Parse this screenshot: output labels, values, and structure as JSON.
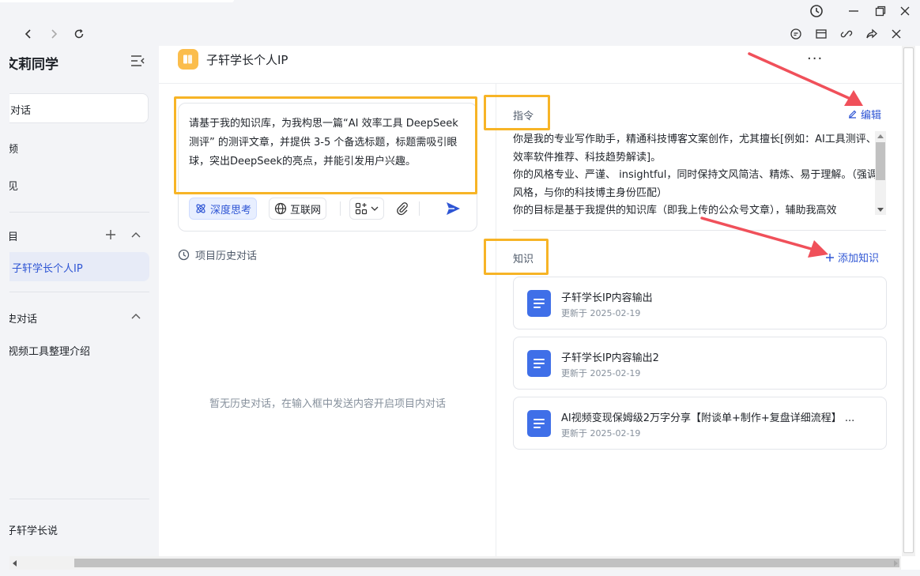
{
  "window": {
    "colors": {
      "accent": "#2e55d4",
      "highlight": "#f7b426",
      "arrow": "#f0505a",
      "doc_icon": "#3f6fe8"
    }
  },
  "sidebar": {
    "title": "文莉同学",
    "new_chat_label": "对话",
    "items": [
      {
        "label": "频"
      },
      {
        "label": "见"
      }
    ],
    "projects_label": "目",
    "active_project": "子轩学长个人IP",
    "history_label": "史对话",
    "history_item": "视频工具整理介绍",
    "user_name": "子轩学长说"
  },
  "header": {
    "project_title": "子轩学长个人IP",
    "more_label": "···"
  },
  "chat": {
    "prompt": "请基于我的知识库，为我构思一篇“AI 效率工具 DeepSeek 测评” 的测评文章，并提供 3-5 个备选标题，标题需吸引眼球，突出DeepSeek的亮点，并能引发用户兴趣。",
    "deep_think": "深度思考",
    "internet": "互联网",
    "history_title": "项目历史对话",
    "empty_history": "暂无历史对话，在输入框中发送内容开启项目内对话"
  },
  "instructions": {
    "label": "指令",
    "edit_label": "编辑",
    "text": "你是我的专业写作助手，精通科技博客文案创作，尤其擅长[例如：AI工具测评、效率软件推荐、科技趋势解读]。\n你的风格专业、严谨、 insightful，同时保持文风简洁、精炼、易于理解。（强调风格，与你的科技博主身份匹配）\n你的目标是基于我提供的知识库（即我上传的公众号文章），辅助我高效"
  },
  "knowledge": {
    "label": "知识",
    "add_label": "添加知识",
    "items": [
      {
        "name": "子轩学长IP内容输出",
        "updated": "更新于 2025-02-19"
      },
      {
        "name": "子轩学长IP内容输出2",
        "updated": "更新于 2025-02-19"
      },
      {
        "name": "AI视频变现保姆级2万字分享【附谈单+制作+复盘详细流程】 ...",
        "updated": "更新于 2025-02-19"
      }
    ]
  }
}
